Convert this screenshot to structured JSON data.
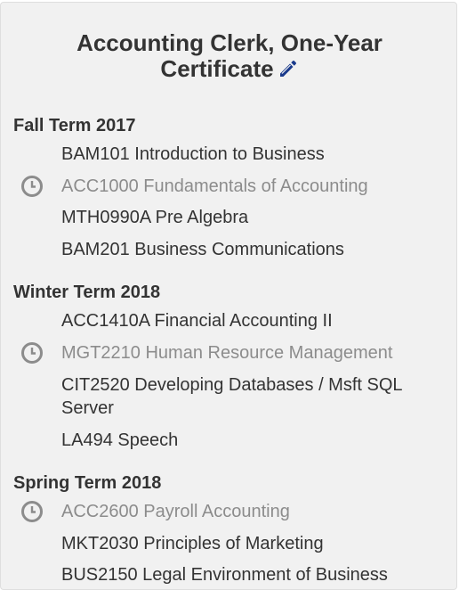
{
  "program": {
    "title_line1": "Accounting Clerk, One-Year",
    "title_line2": "Certificate",
    "edit_icon": "pencil-icon"
  },
  "terms": [
    {
      "name": "Fall Term 2017",
      "courses": [
        {
          "label": "BAM101 Introduction to Business",
          "pending": false
        },
        {
          "label": "ACC1000 Fundamentals of Accounting",
          "pending": true
        },
        {
          "label": "MTH0990A Pre Algebra",
          "pending": false
        },
        {
          "label": "BAM201 Business Communications",
          "pending": false
        }
      ]
    },
    {
      "name": "Winter Term 2018",
      "courses": [
        {
          "label": "ACC1410A Financial Accounting II",
          "pending": false
        },
        {
          "label": "MGT2210 Human Resource Management",
          "pending": true
        },
        {
          "label": "CIT2520 Developing Databases / Msft SQL Server",
          "pending": false
        },
        {
          "label": "LA494 Speech",
          "pending": false
        }
      ]
    },
    {
      "name": "Spring Term 2018",
      "courses": [
        {
          "label": "ACC2600 Payroll Accounting",
          "pending": true
        },
        {
          "label": "MKT2030 Principles of Marketing",
          "pending": false
        },
        {
          "label": "BUS2150 Legal Environment of Business",
          "pending": false
        }
      ]
    }
  ],
  "colors": {
    "panel_bg": "#f1f1f1",
    "text": "#333333",
    "pending_text": "#8c8c8c",
    "clock_icon": "#8c8c8c",
    "edit_icon": "#1a3a8c"
  },
  "icons": {
    "pending": "clock-icon"
  }
}
